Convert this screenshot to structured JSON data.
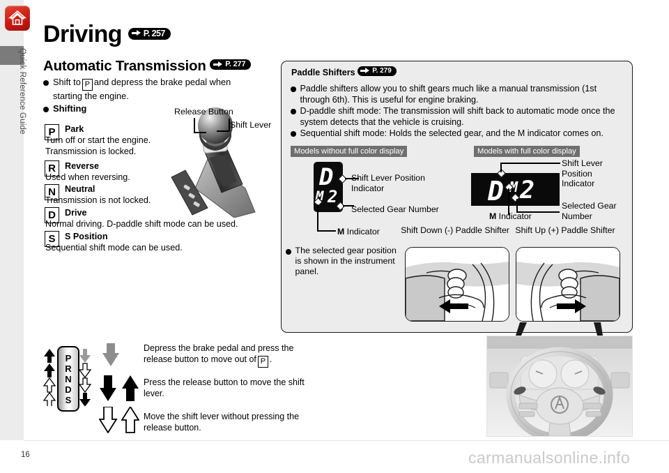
{
  "sidebar": {
    "label": "Quick Reference Guide"
  },
  "header": {
    "home_icon": "home-icon",
    "title": "Driving",
    "title_badge": "P. 257",
    "section_title": "Automatic Transmission",
    "section_badge": "P. 277"
  },
  "left": {
    "intro_before": "Shift to",
    "intro_gear": "P",
    "intro_after": "and depress the brake pedal when starting the engine.",
    "shifting_label": "Shifting",
    "gears": [
      {
        "letter": "P",
        "name": "Park",
        "desc": "Turn off or start the engine.\nTransmission is locked."
      },
      {
        "letter": "R",
        "name": "Reverse",
        "desc": "Used when reversing."
      },
      {
        "letter": "N",
        "name": "Neutral",
        "desc": "Transmission is not locked."
      },
      {
        "letter": "D",
        "name": "Drive",
        "desc": "Normal driving. D-paddle shift mode can be used."
      },
      {
        "letter": "S",
        "name": "S Position",
        "desc": "Sequential shift mode can be used."
      }
    ],
    "lever_callouts": {
      "release_button": "Release Button",
      "shift_lever": "Shift Lever"
    }
  },
  "panel": {
    "title": "Paddle Shifters",
    "title_badge": "P. 279",
    "bullets": [
      "Paddle shifters allow you to shift gears much like a manual transmission (1st through 6th). This is useful for engine braking.",
      "D-paddle shift mode: The transmission will shift back to automatic mode once the system detects that the vehicle is cruising.",
      "Sequential shift mode: Holds the selected gear, and the M indicator comes on."
    ],
    "mono_bar": "Models without full color display",
    "color_bar": "Models with full color display",
    "mono_display": {
      "top": "D",
      "m": "M",
      "gear": "2"
    },
    "color_display": {
      "position": "D",
      "m": "M",
      "gear": "2"
    },
    "mono_callouts": {
      "shift_lever_position": "Shift Lever Position\nIndicator",
      "selected_gear": "Selected Gear Number",
      "m_indicator_bold": "M",
      "m_indicator_rest": " Indicator"
    },
    "color_callouts": {
      "shift_lever_position": "Shift Lever\nPosition\nIndicator",
      "selected_gear": "Selected Gear\nNumber",
      "m_indicator_bold": "M",
      "m_indicator_rest": " Indicator"
    },
    "note_bullet": "The selected gear position is shown in the instrument panel.",
    "paddle_down_caption": "Shift Down (-)\nPaddle Shifter",
    "paddle_up_caption": "Shift Up (+)\nPaddle Shifter"
  },
  "bottom": {
    "gate_letters": [
      "P",
      "R",
      "N",
      "D",
      "S"
    ],
    "legend": [
      "Depress the brake pedal and press the release button to move out of",
      "Press the release button to move the shift lever.",
      "Move the shift lever without pressing the release button."
    ],
    "legend_gear": "P"
  },
  "footer": {
    "page_number": "16",
    "watermark": "carmanualsonline.info"
  }
}
